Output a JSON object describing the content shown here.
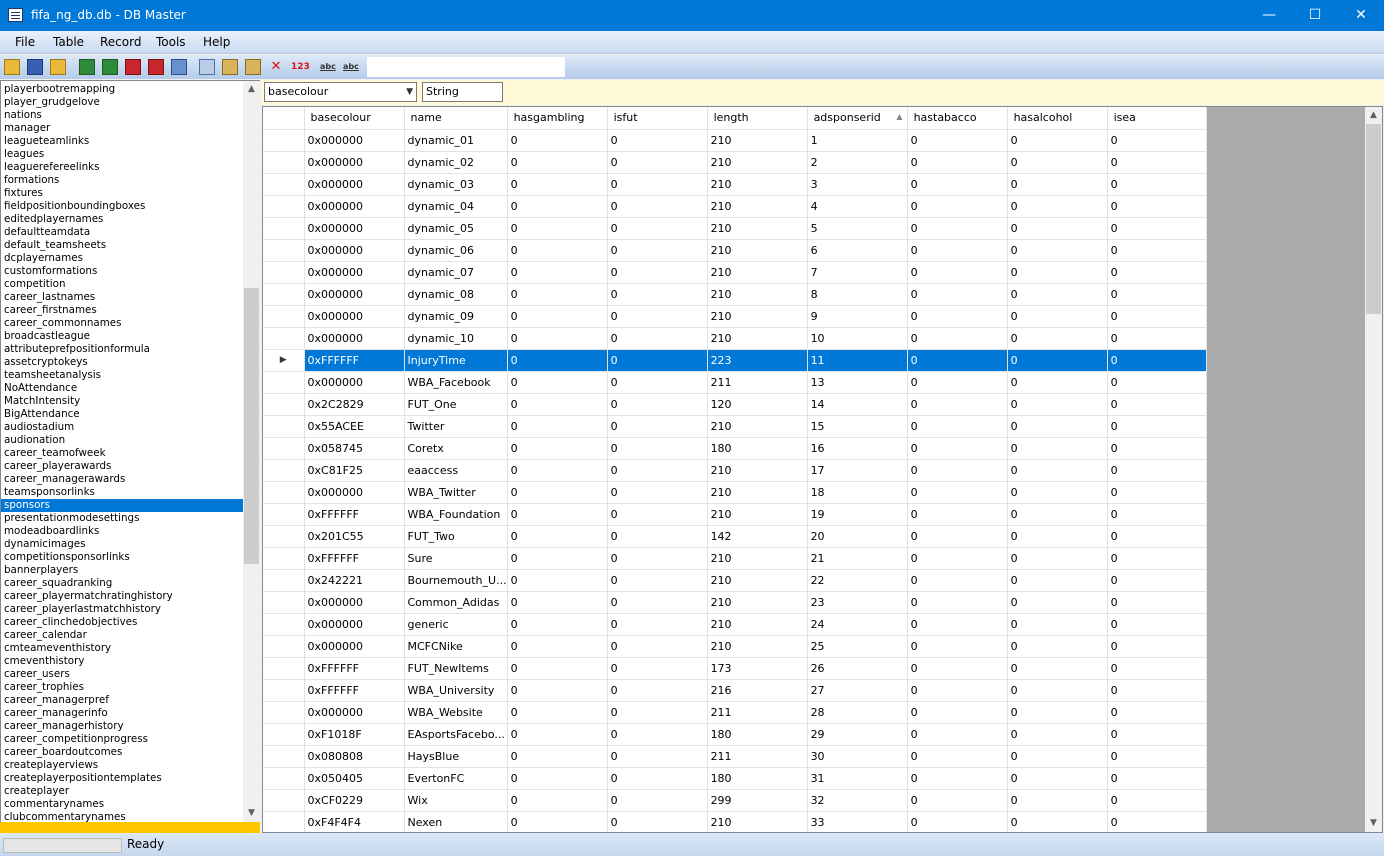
{
  "window": {
    "title": "fifa_ng_db.db - DB Master",
    "min": "—",
    "max": "☐",
    "close": "✕"
  },
  "menu": [
    "File",
    "Table",
    "Record",
    "Tools",
    "Help"
  ],
  "tables": [
    "playerbootremapping",
    "player_grudgelove",
    "nations",
    "manager",
    "leagueteamlinks",
    "leagues",
    "leaguerefereelinks",
    "formations",
    "fixtures",
    "fieldpositionboundingboxes",
    "editedplayernames",
    "defaultteamdata",
    "default_teamsheets",
    "dcplayernames",
    "customformations",
    "competition",
    "career_lastnames",
    "career_firstnames",
    "career_commonnames",
    "broadcastleague",
    "attributeprefpositionformula",
    "assetcryptokeys",
    "teamsheetanalysis",
    "NoAttendance",
    "MatchIntensity",
    "BigAttendance",
    "audiostadium",
    "audionation",
    "career_teamofweek",
    "career_playerawards",
    "career_managerawards",
    "teamsponsorlinks",
    "sponsors",
    "presentationmodesettings",
    "modeadboardlinks",
    "dynamicimages",
    "competitionsponsorlinks",
    "bannerplayers",
    "career_squadranking",
    "career_playermatchratinghistory",
    "career_playerlastmatchhistory",
    "career_clinchedobjectives",
    "career_calendar",
    "cmteameventhistory",
    "cmeventhistory",
    "career_users",
    "career_trophies",
    "career_managerpref",
    "career_managerinfo",
    "career_managerhistory",
    "career_competitionprogress",
    "career_boardoutcomes",
    "createplayerviews",
    "createplayerpositiontemplates",
    "createplayer",
    "commentarynames",
    "clubcommentarynames"
  ],
  "selected_table": "sponsors",
  "filter": {
    "field": "basecolour",
    "type": "String"
  },
  "columns": [
    "basecolour",
    "name",
    "hasgambling",
    "isfut",
    "length",
    "adsponserid",
    "hastabacco",
    "hasalcohol",
    "isea"
  ],
  "rows": [
    [
      "0x000000",
      "dynamic_01",
      "0",
      "0",
      "210",
      "1",
      "0",
      "0",
      "0"
    ],
    [
      "0x000000",
      "dynamic_02",
      "0",
      "0",
      "210",
      "2",
      "0",
      "0",
      "0"
    ],
    [
      "0x000000",
      "dynamic_03",
      "0",
      "0",
      "210",
      "3",
      "0",
      "0",
      "0"
    ],
    [
      "0x000000",
      "dynamic_04",
      "0",
      "0",
      "210",
      "4",
      "0",
      "0",
      "0"
    ],
    [
      "0x000000",
      "dynamic_05",
      "0",
      "0",
      "210",
      "5",
      "0",
      "0",
      "0"
    ],
    [
      "0x000000",
      "dynamic_06",
      "0",
      "0",
      "210",
      "6",
      "0",
      "0",
      "0"
    ],
    [
      "0x000000",
      "dynamic_07",
      "0",
      "0",
      "210",
      "7",
      "0",
      "0",
      "0"
    ],
    [
      "0x000000",
      "dynamic_08",
      "0",
      "0",
      "210",
      "8",
      "0",
      "0",
      "0"
    ],
    [
      "0x000000",
      "dynamic_09",
      "0",
      "0",
      "210",
      "9",
      "0",
      "0",
      "0"
    ],
    [
      "0x000000",
      "dynamic_10",
      "0",
      "0",
      "210",
      "10",
      "0",
      "0",
      "0"
    ],
    [
      "0xFFFFFF",
      "InjuryTime",
      "0",
      "0",
      "223",
      "11",
      "0",
      "0",
      "0"
    ],
    [
      "0x000000",
      "WBA_Facebook",
      "0",
      "0",
      "211",
      "13",
      "0",
      "0",
      "0"
    ],
    [
      "0x2C2829",
      "FUT_One",
      "0",
      "0",
      "120",
      "14",
      "0",
      "0",
      "0"
    ],
    [
      "0x55ACEE",
      "Twitter",
      "0",
      "0",
      "210",
      "15",
      "0",
      "0",
      "0"
    ],
    [
      "0x058745",
      "Coretx",
      "0",
      "0",
      "180",
      "16",
      "0",
      "0",
      "0"
    ],
    [
      "0xC81F25",
      "eaaccess",
      "0",
      "0",
      "210",
      "17",
      "0",
      "0",
      "0"
    ],
    [
      "0x000000",
      "WBA_Twitter",
      "0",
      "0",
      "210",
      "18",
      "0",
      "0",
      "0"
    ],
    [
      "0xFFFFFF",
      "WBA_Foundation",
      "0",
      "0",
      "210",
      "19",
      "0",
      "0",
      "0"
    ],
    [
      "0x201C55",
      "FUT_Two",
      "0",
      "0",
      "142",
      "20",
      "0",
      "0",
      "0"
    ],
    [
      "0xFFFFFF",
      "Sure",
      "0",
      "0",
      "210",
      "21",
      "0",
      "0",
      "0"
    ],
    [
      "0x242221",
      "Bournemouth_U...",
      "0",
      "0",
      "210",
      "22",
      "0",
      "0",
      "0"
    ],
    [
      "0x000000",
      "Common_Adidas",
      "0",
      "0",
      "210",
      "23",
      "0",
      "0",
      "0"
    ],
    [
      "0x000000",
      "generic",
      "0",
      "0",
      "210",
      "24",
      "0",
      "0",
      "0"
    ],
    [
      "0x000000",
      "MCFCNike",
      "0",
      "0",
      "210",
      "25",
      "0",
      "0",
      "0"
    ],
    [
      "0xFFFFFF",
      "FUT_NewItems",
      "0",
      "0",
      "173",
      "26",
      "0",
      "0",
      "0"
    ],
    [
      "0xFFFFFF",
      "WBA_University",
      "0",
      "0",
      "216",
      "27",
      "0",
      "0",
      "0"
    ],
    [
      "0x000000",
      "WBA_Website",
      "0",
      "0",
      "211",
      "28",
      "0",
      "0",
      "0"
    ],
    [
      "0xF1018F",
      "EAsportsFacebo...",
      "0",
      "0",
      "180",
      "29",
      "0",
      "0",
      "0"
    ],
    [
      "0x080808",
      "HaysBlue",
      "0",
      "0",
      "211",
      "30",
      "0",
      "0",
      "0"
    ],
    [
      "0x050405",
      "EvertonFC",
      "0",
      "0",
      "180",
      "31",
      "0",
      "0",
      "0"
    ],
    [
      "0xCF0229",
      "Wix",
      "0",
      "0",
      "299",
      "32",
      "0",
      "0",
      "0"
    ],
    [
      "0xF4F4F4",
      "Nexen",
      "0",
      "0",
      "210",
      "33",
      "0",
      "0",
      "0"
    ]
  ],
  "selected_row": 10,
  "sorted_column": "adsponserid",
  "status": "Ready",
  "colors": {
    "accent": "#0078d7",
    "sidebar_footer": "#ffc700",
    "filter_bg": "#fff9d8"
  }
}
